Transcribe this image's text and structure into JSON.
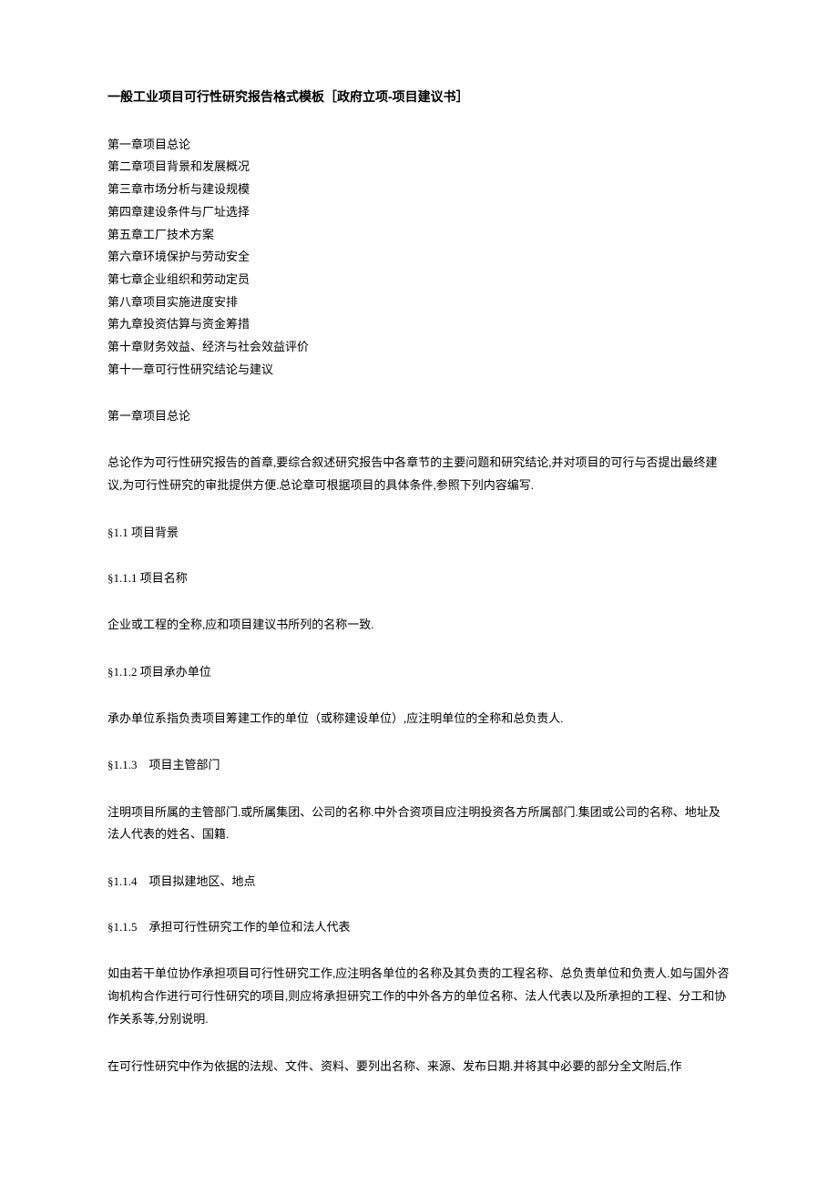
{
  "title": "一般工业项目可行性研究报告格式模板［政府立项-项目建议书］",
  "toc": [
    "第一章项目总论",
    "第二章项目背景和发展概况",
    "第三章市场分析与建设规模",
    "第四章建设条件与厂址选择",
    "第五章工厂技术方案",
    "第六章环境保护与劳动安全",
    "第七章企业组织和劳动定员",
    "第八章项目实施进度安排",
    "第九章投资估算与资金筹措",
    "第十章财务效益、经济与社会效益评价",
    "第十一章可行性研究结论与建议"
  ],
  "chapter1_heading": "第一章项目总论",
  "chapter1_intro": "总论作为可行性研究报告的首章,要综合叙述研究报告中各章节的主要问题和研究结论,并对项目的可行与否提出最终建议,为可行性研究的审批提供方便.总论章可根据项目的具体条件,参照下列内容编写.",
  "sections": {
    "s1_1": "§1.1 项目背景",
    "s1_1_1": "§1.1.1 项目名称",
    "s1_1_1_body": "企业或工程的全称,应和项目建议书所列的名称一致.",
    "s1_1_2": "§1.1.2 项目承办单位",
    "s1_1_2_body": "承办单位系指负责项目筹建工作的单位（或称建设单位）,应注明单位的全称和总负责人.",
    "s1_1_3": "§1.1.3　项目主管部门",
    "s1_1_3_body": "注明项目所属的主管部门.或所属集团、公司的名称.中外合资项目应注明投资各方所属部门.集团或公司的名称、地址及法人代表的姓名、国籍.",
    "s1_1_4": "§1.1.4　项目拟建地区、地点",
    "s1_1_5": "§1.1.5　承担可行性研究工作的单位和法人代表",
    "s1_1_5_body": "如由若干单位协作承担项目可行性研究工作,应注明各单位的名称及其负责的工程名称、总负责单位和负责人.如与国外咨询机构合作进行可行性研究的项目,则应将承担研究工作的中外各方的单位名称、法人代表以及所承担的工程、分工和协作关系等,分别说明.",
    "s1_1_5_body2": "在可行性研究中作为依据的法规、文件、资料、要列出名称、来源、发布日期.并将其中必要的部分全文附后,作"
  }
}
